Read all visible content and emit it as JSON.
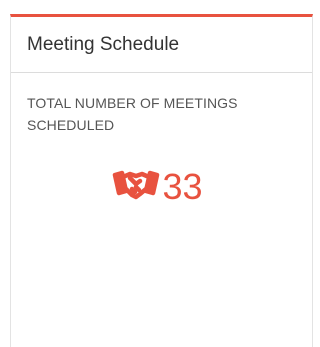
{
  "card": {
    "title": "Meeting Schedule",
    "accent_color": "#e8523f"
  },
  "metric": {
    "label": "TOTAL NUMBER OF MEETINGS SCHEDULED",
    "icon": "handshake-icon",
    "value": "33"
  }
}
